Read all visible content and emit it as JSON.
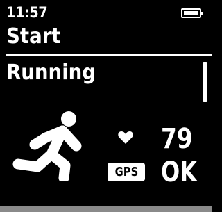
{
  "status_bar": {
    "time": "11:57",
    "battery_icon": "battery-full-icon",
    "battery_level": 1.0
  },
  "header": {
    "title": "Start"
  },
  "activity": {
    "name": "Running",
    "icon": "runner-icon"
  },
  "sensors": {
    "heart_rate_icon": "heart-icon",
    "heart_rate_value": "79",
    "gps_label": "GPS",
    "gps_status": "OK"
  },
  "colors": {
    "background": "#000000",
    "foreground": "#ffffff",
    "footer": "#8a8a8a"
  }
}
